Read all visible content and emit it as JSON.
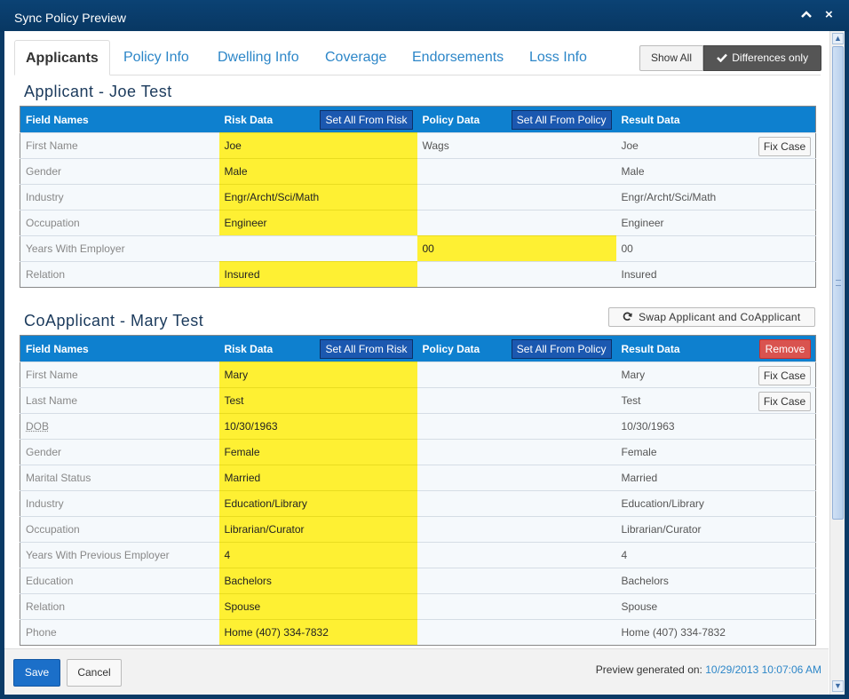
{
  "window": {
    "title": "Sync Policy Preview",
    "minimize_glyph": "^",
    "close_glyph": "×"
  },
  "tabs": [
    "Applicants",
    "Policy Info",
    "Dwelling Info",
    "Coverage",
    "Endorsements",
    "Loss Info"
  ],
  "filter": {
    "show_all": "Show All",
    "differences_only": "Differences only",
    "selected": "Differences only"
  },
  "headers": {
    "field_names": "Field Names",
    "risk_data": "Risk Data",
    "policy_data": "Policy Data",
    "result_data": "Result Data",
    "set_all_risk": "Set All From Risk",
    "set_all_policy": "Set All From Policy"
  },
  "applicant": {
    "heading": "Applicant - Joe Test",
    "rows": [
      {
        "field": "First Name",
        "risk": "Joe",
        "policy": "Wags",
        "result": "Joe",
        "fix": "Fix Case"
      },
      {
        "field": "Gender",
        "risk": "Male",
        "policy": "",
        "result": "Male"
      },
      {
        "field": "Industry",
        "risk": "Engr/Archt/Sci/Math",
        "policy": "",
        "result": "Engr/Archt/Sci/Math"
      },
      {
        "field": "Occupation",
        "risk": "Engineer",
        "policy": "",
        "result": "Engineer"
      },
      {
        "field": "Years With Employer",
        "risk": "",
        "policy": "00",
        "result": "00"
      },
      {
        "field": "Relation",
        "risk": "Insured",
        "policy": "",
        "result": "Insured"
      }
    ]
  },
  "coapplicant": {
    "heading": "CoApplicant - Mary Test",
    "swap_label": "Swap Applicant and CoApplicant",
    "remove_label": "Remove",
    "rows": [
      {
        "field": "First Name",
        "risk": "Mary",
        "policy": "",
        "result": "Mary",
        "fix": "Fix Case"
      },
      {
        "field": "Last Name",
        "risk": "Test",
        "policy": "",
        "result": "Test",
        "fix": "Fix Case"
      },
      {
        "field": "DOB",
        "risk": "10/30/1963",
        "policy": "",
        "result": "10/30/1963"
      },
      {
        "field": "Gender",
        "risk": "Female",
        "policy": "",
        "result": "Female"
      },
      {
        "field": "Marital Status",
        "risk": "Married",
        "policy": "",
        "result": "Married"
      },
      {
        "field": "Industry",
        "risk": "Education/Library",
        "policy": "",
        "result": "Education/Library"
      },
      {
        "field": "Occupation",
        "risk": "Librarian/Curator",
        "policy": "",
        "result": "Librarian/Curator"
      },
      {
        "field": "Years With Previous Employer",
        "risk": "4",
        "policy": "",
        "result": "4"
      },
      {
        "field": "Education",
        "risk": "Bachelors",
        "policy": "",
        "result": "Bachelors"
      },
      {
        "field": "Relation",
        "risk": "Spouse",
        "policy": "",
        "result": "Spouse"
      },
      {
        "field": "Phone",
        "risk": "Home (407) 334-7832",
        "policy": "",
        "result": "Home (407) 334-7832"
      }
    ]
  },
  "footer": {
    "save": "Save",
    "cancel": "Cancel",
    "generated_label": "Preview generated on:",
    "generated_at": "10/29/2013 10:07:06 AM"
  },
  "colors": {
    "header_blue": "#0e80cf",
    "highlight_yellow": "#fef033",
    "link_blue": "#2c86c8",
    "remove_red": "#d9534f"
  }
}
